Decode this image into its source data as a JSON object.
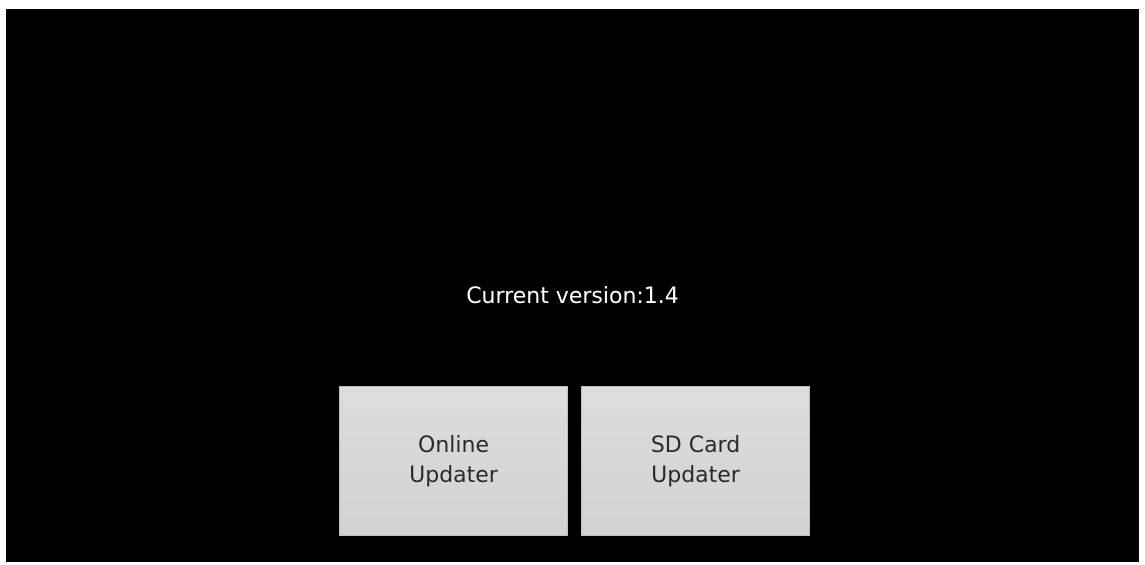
{
  "screen": {
    "version_text": "Current version:1.4"
  },
  "buttons": {
    "online_label": "Online Updater",
    "sd_label": "SD Card Updater"
  },
  "colors": {
    "background": "#000000",
    "text": "#ffffff",
    "button_face": "#d8d8d8",
    "button_text": "#2a2a2a"
  }
}
